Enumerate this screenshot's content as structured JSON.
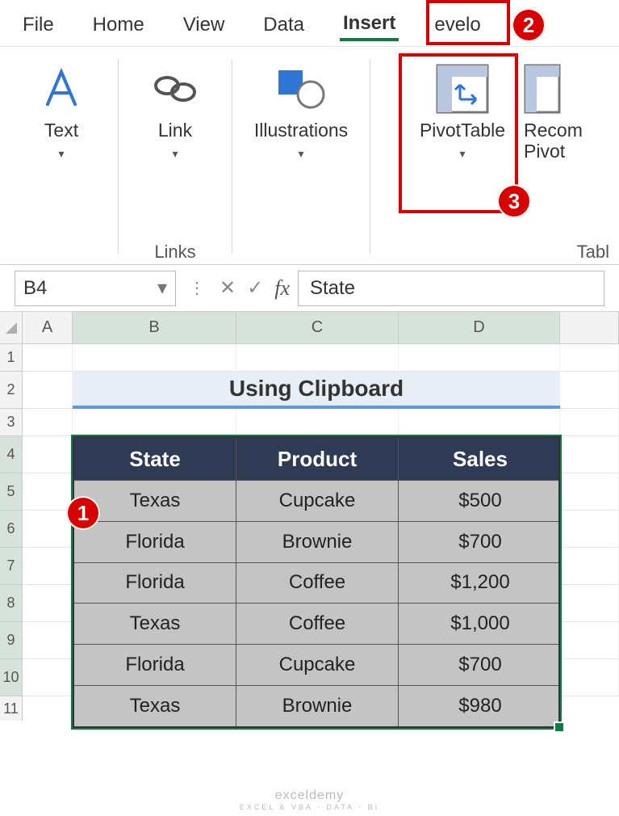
{
  "tabs": {
    "file": "File",
    "home": "Home",
    "view": "View",
    "data": "Data",
    "insert": "Insert",
    "developer_partial": "evelo"
  },
  "ribbon": {
    "text": {
      "label": "Text"
    },
    "link": {
      "label": "Link",
      "groupCaption": "Links"
    },
    "illustrations": {
      "label": "Illustrations"
    },
    "pivotTable": {
      "label": "PivotTable"
    },
    "recommended_partial_line1": "Recom",
    "recommended_partial_line2": "Pivot",
    "tables_caption_partial": "Tabl"
  },
  "nameBox": "B4",
  "formulaValue": "State",
  "columns": {
    "A": "A",
    "B": "B",
    "C": "C",
    "D": "D",
    "E": ""
  },
  "rows": [
    "1",
    "2",
    "3",
    "4",
    "5",
    "6",
    "7",
    "8",
    "9",
    "10",
    "11"
  ],
  "titleCell": "Using Clipboard",
  "table": {
    "headers": {
      "state": "State",
      "product": "Product",
      "sales": "Sales"
    },
    "rows": [
      {
        "state": "Texas",
        "product": "Cupcake",
        "sales": "$500"
      },
      {
        "state": "Florida",
        "product": "Brownie",
        "sales": "$700"
      },
      {
        "state": "Florida",
        "product": "Coffee",
        "sales": "$1,200"
      },
      {
        "state": "Texas",
        "product": "Coffee",
        "sales": "$1,000"
      },
      {
        "state": "Florida",
        "product": "Cupcake",
        "sales": "$700"
      },
      {
        "state": "Texas",
        "product": "Brownie",
        "sales": "$980"
      }
    ]
  },
  "annotations": {
    "badge1": "1",
    "badge2": "2",
    "badge3": "3"
  },
  "watermark": {
    "main": "exceldemy",
    "sub": "EXCEL & VBA · DATA · BI"
  },
  "chart_data": {
    "type": "table",
    "title": "Using Clipboard",
    "columns": [
      "State",
      "Product",
      "Sales"
    ],
    "rows": [
      [
        "Texas",
        "Cupcake",
        500
      ],
      [
        "Florida",
        "Brownie",
        700
      ],
      [
        "Florida",
        "Coffee",
        1200
      ],
      [
        "Texas",
        "Coffee",
        1000
      ],
      [
        "Florida",
        "Cupcake",
        700
      ],
      [
        "Texas",
        "Brownie",
        980
      ]
    ]
  }
}
